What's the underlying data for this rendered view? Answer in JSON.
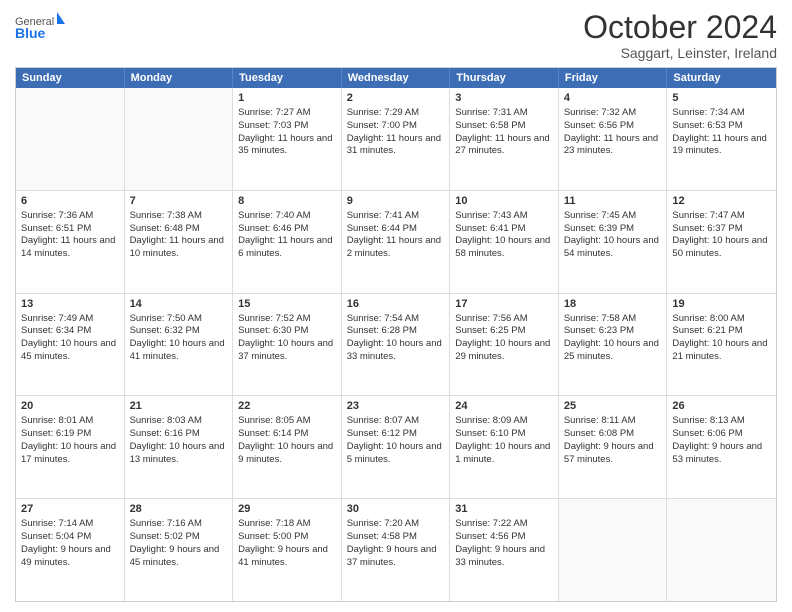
{
  "logo": {
    "general": "General",
    "blue": "Blue"
  },
  "title": "October 2024",
  "subtitle": "Saggart, Leinster, Ireland",
  "days": [
    "Sunday",
    "Monday",
    "Tuesday",
    "Wednesday",
    "Thursday",
    "Friday",
    "Saturday"
  ],
  "weeks": [
    [
      {
        "day": "",
        "sunrise": "",
        "sunset": "",
        "daylight": "",
        "empty": true
      },
      {
        "day": "",
        "sunrise": "",
        "sunset": "",
        "daylight": "",
        "empty": true
      },
      {
        "day": "1",
        "sunrise": "Sunrise: 7:27 AM",
        "sunset": "Sunset: 7:03 PM",
        "daylight": "Daylight: 11 hours and 35 minutes.",
        "empty": false
      },
      {
        "day": "2",
        "sunrise": "Sunrise: 7:29 AM",
        "sunset": "Sunset: 7:00 PM",
        "daylight": "Daylight: 11 hours and 31 minutes.",
        "empty": false
      },
      {
        "day": "3",
        "sunrise": "Sunrise: 7:31 AM",
        "sunset": "Sunset: 6:58 PM",
        "daylight": "Daylight: 11 hours and 27 minutes.",
        "empty": false
      },
      {
        "day": "4",
        "sunrise": "Sunrise: 7:32 AM",
        "sunset": "Sunset: 6:56 PM",
        "daylight": "Daylight: 11 hours and 23 minutes.",
        "empty": false
      },
      {
        "day": "5",
        "sunrise": "Sunrise: 7:34 AM",
        "sunset": "Sunset: 6:53 PM",
        "daylight": "Daylight: 11 hours and 19 minutes.",
        "empty": false
      }
    ],
    [
      {
        "day": "6",
        "sunrise": "Sunrise: 7:36 AM",
        "sunset": "Sunset: 6:51 PM",
        "daylight": "Daylight: 11 hours and 14 minutes.",
        "empty": false
      },
      {
        "day": "7",
        "sunrise": "Sunrise: 7:38 AM",
        "sunset": "Sunset: 6:48 PM",
        "daylight": "Daylight: 11 hours and 10 minutes.",
        "empty": false
      },
      {
        "day": "8",
        "sunrise": "Sunrise: 7:40 AM",
        "sunset": "Sunset: 6:46 PM",
        "daylight": "Daylight: 11 hours and 6 minutes.",
        "empty": false
      },
      {
        "day": "9",
        "sunrise": "Sunrise: 7:41 AM",
        "sunset": "Sunset: 6:44 PM",
        "daylight": "Daylight: 11 hours and 2 minutes.",
        "empty": false
      },
      {
        "day": "10",
        "sunrise": "Sunrise: 7:43 AM",
        "sunset": "Sunset: 6:41 PM",
        "daylight": "Daylight: 10 hours and 58 minutes.",
        "empty": false
      },
      {
        "day": "11",
        "sunrise": "Sunrise: 7:45 AM",
        "sunset": "Sunset: 6:39 PM",
        "daylight": "Daylight: 10 hours and 54 minutes.",
        "empty": false
      },
      {
        "day": "12",
        "sunrise": "Sunrise: 7:47 AM",
        "sunset": "Sunset: 6:37 PM",
        "daylight": "Daylight: 10 hours and 50 minutes.",
        "empty": false
      }
    ],
    [
      {
        "day": "13",
        "sunrise": "Sunrise: 7:49 AM",
        "sunset": "Sunset: 6:34 PM",
        "daylight": "Daylight: 10 hours and 45 minutes.",
        "empty": false
      },
      {
        "day": "14",
        "sunrise": "Sunrise: 7:50 AM",
        "sunset": "Sunset: 6:32 PM",
        "daylight": "Daylight: 10 hours and 41 minutes.",
        "empty": false
      },
      {
        "day": "15",
        "sunrise": "Sunrise: 7:52 AM",
        "sunset": "Sunset: 6:30 PM",
        "daylight": "Daylight: 10 hours and 37 minutes.",
        "empty": false
      },
      {
        "day": "16",
        "sunrise": "Sunrise: 7:54 AM",
        "sunset": "Sunset: 6:28 PM",
        "daylight": "Daylight: 10 hours and 33 minutes.",
        "empty": false
      },
      {
        "day": "17",
        "sunrise": "Sunrise: 7:56 AM",
        "sunset": "Sunset: 6:25 PM",
        "daylight": "Daylight: 10 hours and 29 minutes.",
        "empty": false
      },
      {
        "day": "18",
        "sunrise": "Sunrise: 7:58 AM",
        "sunset": "Sunset: 6:23 PM",
        "daylight": "Daylight: 10 hours and 25 minutes.",
        "empty": false
      },
      {
        "day": "19",
        "sunrise": "Sunrise: 8:00 AM",
        "sunset": "Sunset: 6:21 PM",
        "daylight": "Daylight: 10 hours and 21 minutes.",
        "empty": false
      }
    ],
    [
      {
        "day": "20",
        "sunrise": "Sunrise: 8:01 AM",
        "sunset": "Sunset: 6:19 PM",
        "daylight": "Daylight: 10 hours and 17 minutes.",
        "empty": false
      },
      {
        "day": "21",
        "sunrise": "Sunrise: 8:03 AM",
        "sunset": "Sunset: 6:16 PM",
        "daylight": "Daylight: 10 hours and 13 minutes.",
        "empty": false
      },
      {
        "day": "22",
        "sunrise": "Sunrise: 8:05 AM",
        "sunset": "Sunset: 6:14 PM",
        "daylight": "Daylight: 10 hours and 9 minutes.",
        "empty": false
      },
      {
        "day": "23",
        "sunrise": "Sunrise: 8:07 AM",
        "sunset": "Sunset: 6:12 PM",
        "daylight": "Daylight: 10 hours and 5 minutes.",
        "empty": false
      },
      {
        "day": "24",
        "sunrise": "Sunrise: 8:09 AM",
        "sunset": "Sunset: 6:10 PM",
        "daylight": "Daylight: 10 hours and 1 minute.",
        "empty": false
      },
      {
        "day": "25",
        "sunrise": "Sunrise: 8:11 AM",
        "sunset": "Sunset: 6:08 PM",
        "daylight": "Daylight: 9 hours and 57 minutes.",
        "empty": false
      },
      {
        "day": "26",
        "sunrise": "Sunrise: 8:13 AM",
        "sunset": "Sunset: 6:06 PM",
        "daylight": "Daylight: 9 hours and 53 minutes.",
        "empty": false
      }
    ],
    [
      {
        "day": "27",
        "sunrise": "Sunrise: 7:14 AM",
        "sunset": "Sunset: 5:04 PM",
        "daylight": "Daylight: 9 hours and 49 minutes.",
        "empty": false
      },
      {
        "day": "28",
        "sunrise": "Sunrise: 7:16 AM",
        "sunset": "Sunset: 5:02 PM",
        "daylight": "Daylight: 9 hours and 45 minutes.",
        "empty": false
      },
      {
        "day": "29",
        "sunrise": "Sunrise: 7:18 AM",
        "sunset": "Sunset: 5:00 PM",
        "daylight": "Daylight: 9 hours and 41 minutes.",
        "empty": false
      },
      {
        "day": "30",
        "sunrise": "Sunrise: 7:20 AM",
        "sunset": "Sunset: 4:58 PM",
        "daylight": "Daylight: 9 hours and 37 minutes.",
        "empty": false
      },
      {
        "day": "31",
        "sunrise": "Sunrise: 7:22 AM",
        "sunset": "Sunset: 4:56 PM",
        "daylight": "Daylight: 9 hours and 33 minutes.",
        "empty": false
      },
      {
        "day": "",
        "sunrise": "",
        "sunset": "",
        "daylight": "",
        "empty": true
      },
      {
        "day": "",
        "sunrise": "",
        "sunset": "",
        "daylight": "",
        "empty": true
      }
    ]
  ]
}
